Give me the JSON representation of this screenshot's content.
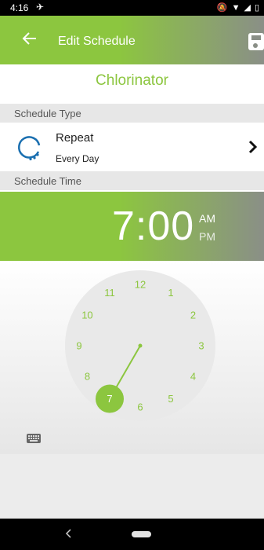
{
  "status_bar": {
    "time": "4:16"
  },
  "app_bar": {
    "title": "Edit Schedule"
  },
  "device_name": "Chlorinator",
  "schedule_type": {
    "header": "Schedule Type",
    "repeat_label": "Repeat",
    "repeat_sub": "Every Day"
  },
  "schedule_time": {
    "header": "Schedule Time",
    "time": "7:00",
    "am": "AM",
    "pm": "PM"
  },
  "clock": {
    "numbers": [
      "12",
      "1",
      "2",
      "3",
      "4",
      "5",
      "6",
      "7",
      "8",
      "9",
      "10",
      "11"
    ],
    "selected": "7"
  },
  "colors": {
    "accent": "#8cc63f",
    "gray": "#8a8f87",
    "icon_blue": "#1a6fb0"
  }
}
